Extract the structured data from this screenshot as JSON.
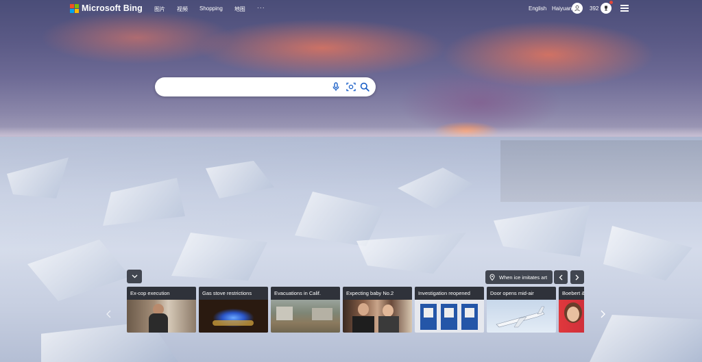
{
  "brand": {
    "name": "Microsoft Bing",
    "logo_colors": [
      "#f25022",
      "#7fba00",
      "#00a4ef",
      "#ffb900"
    ]
  },
  "nav": {
    "items": [
      "图片",
      "视频",
      "Shopping",
      "地图"
    ],
    "more": "···"
  },
  "header": {
    "language": "English",
    "username": "Haiyuan",
    "points": "392"
  },
  "search": {
    "value": "",
    "placeholder": "",
    "icons": [
      "microphone-icon",
      "visual-search-icon",
      "search-icon"
    ],
    "accent": "#1a5fc7"
  },
  "background_caption": "When ice imitates art",
  "news": {
    "cards": [
      {
        "title": "Ex-cop execution",
        "image": "man-in-tank-top"
      },
      {
        "title": "Gas stove restrictions",
        "image": "gas-burner-flame"
      },
      {
        "title": "Evacuations in Calif.",
        "image": "flooded-street"
      },
      {
        "title": "Expecting baby No.2",
        "image": "couple-portrait"
      },
      {
        "title": "Investigation reopened",
        "image": "missing-posters"
      },
      {
        "title": "Door opens mid-air",
        "image": "passenger-jet"
      },
      {
        "title": "Boebert &",
        "image": "woman-portrait"
      }
    ]
  }
}
